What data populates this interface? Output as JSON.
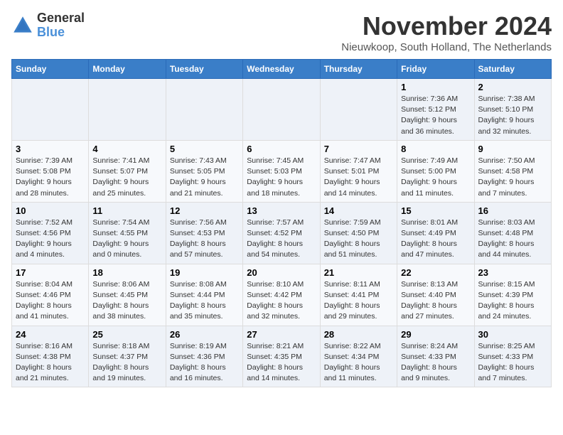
{
  "app": {
    "logo_line1": "General",
    "logo_line2": "Blue"
  },
  "header": {
    "month_title": "November 2024",
    "subtitle": "Nieuwkoop, South Holland, The Netherlands"
  },
  "weekdays": [
    "Sunday",
    "Monday",
    "Tuesday",
    "Wednesday",
    "Thursday",
    "Friday",
    "Saturday"
  ],
  "weeks": [
    [
      {
        "day": "",
        "info": ""
      },
      {
        "day": "",
        "info": ""
      },
      {
        "day": "",
        "info": ""
      },
      {
        "day": "",
        "info": ""
      },
      {
        "day": "",
        "info": ""
      },
      {
        "day": "1",
        "info": "Sunrise: 7:36 AM\nSunset: 5:12 PM\nDaylight: 9 hours\nand 36 minutes."
      },
      {
        "day": "2",
        "info": "Sunrise: 7:38 AM\nSunset: 5:10 PM\nDaylight: 9 hours\nand 32 minutes."
      }
    ],
    [
      {
        "day": "3",
        "info": "Sunrise: 7:39 AM\nSunset: 5:08 PM\nDaylight: 9 hours\nand 28 minutes."
      },
      {
        "day": "4",
        "info": "Sunrise: 7:41 AM\nSunset: 5:07 PM\nDaylight: 9 hours\nand 25 minutes."
      },
      {
        "day": "5",
        "info": "Sunrise: 7:43 AM\nSunset: 5:05 PM\nDaylight: 9 hours\nand 21 minutes."
      },
      {
        "day": "6",
        "info": "Sunrise: 7:45 AM\nSunset: 5:03 PM\nDaylight: 9 hours\nand 18 minutes."
      },
      {
        "day": "7",
        "info": "Sunrise: 7:47 AM\nSunset: 5:01 PM\nDaylight: 9 hours\nand 14 minutes."
      },
      {
        "day": "8",
        "info": "Sunrise: 7:49 AM\nSunset: 5:00 PM\nDaylight: 9 hours\nand 11 minutes."
      },
      {
        "day": "9",
        "info": "Sunrise: 7:50 AM\nSunset: 4:58 PM\nDaylight: 9 hours\nand 7 minutes."
      }
    ],
    [
      {
        "day": "10",
        "info": "Sunrise: 7:52 AM\nSunset: 4:56 PM\nDaylight: 9 hours\nand 4 minutes."
      },
      {
        "day": "11",
        "info": "Sunrise: 7:54 AM\nSunset: 4:55 PM\nDaylight: 9 hours\nand 0 minutes."
      },
      {
        "day": "12",
        "info": "Sunrise: 7:56 AM\nSunset: 4:53 PM\nDaylight: 8 hours\nand 57 minutes."
      },
      {
        "day": "13",
        "info": "Sunrise: 7:57 AM\nSunset: 4:52 PM\nDaylight: 8 hours\nand 54 minutes."
      },
      {
        "day": "14",
        "info": "Sunrise: 7:59 AM\nSunset: 4:50 PM\nDaylight: 8 hours\nand 51 minutes."
      },
      {
        "day": "15",
        "info": "Sunrise: 8:01 AM\nSunset: 4:49 PM\nDaylight: 8 hours\nand 47 minutes."
      },
      {
        "day": "16",
        "info": "Sunrise: 8:03 AM\nSunset: 4:48 PM\nDaylight: 8 hours\nand 44 minutes."
      }
    ],
    [
      {
        "day": "17",
        "info": "Sunrise: 8:04 AM\nSunset: 4:46 PM\nDaylight: 8 hours\nand 41 minutes."
      },
      {
        "day": "18",
        "info": "Sunrise: 8:06 AM\nSunset: 4:45 PM\nDaylight: 8 hours\nand 38 minutes."
      },
      {
        "day": "19",
        "info": "Sunrise: 8:08 AM\nSunset: 4:44 PM\nDaylight: 8 hours\nand 35 minutes."
      },
      {
        "day": "20",
        "info": "Sunrise: 8:10 AM\nSunset: 4:42 PM\nDaylight: 8 hours\nand 32 minutes."
      },
      {
        "day": "21",
        "info": "Sunrise: 8:11 AM\nSunset: 4:41 PM\nDaylight: 8 hours\nand 29 minutes."
      },
      {
        "day": "22",
        "info": "Sunrise: 8:13 AM\nSunset: 4:40 PM\nDaylight: 8 hours\nand 27 minutes."
      },
      {
        "day": "23",
        "info": "Sunrise: 8:15 AM\nSunset: 4:39 PM\nDaylight: 8 hours\nand 24 minutes."
      }
    ],
    [
      {
        "day": "24",
        "info": "Sunrise: 8:16 AM\nSunset: 4:38 PM\nDaylight: 8 hours\nand 21 minutes."
      },
      {
        "day": "25",
        "info": "Sunrise: 8:18 AM\nSunset: 4:37 PM\nDaylight: 8 hours\nand 19 minutes."
      },
      {
        "day": "26",
        "info": "Sunrise: 8:19 AM\nSunset: 4:36 PM\nDaylight: 8 hours\nand 16 minutes."
      },
      {
        "day": "27",
        "info": "Sunrise: 8:21 AM\nSunset: 4:35 PM\nDaylight: 8 hours\nand 14 minutes."
      },
      {
        "day": "28",
        "info": "Sunrise: 8:22 AM\nSunset: 4:34 PM\nDaylight: 8 hours\nand 11 minutes."
      },
      {
        "day": "29",
        "info": "Sunrise: 8:24 AM\nSunset: 4:33 PM\nDaylight: 8 hours\nand 9 minutes."
      },
      {
        "day": "30",
        "info": "Sunrise: 8:25 AM\nSunset: 4:33 PM\nDaylight: 8 hours\nand 7 minutes."
      }
    ]
  ]
}
